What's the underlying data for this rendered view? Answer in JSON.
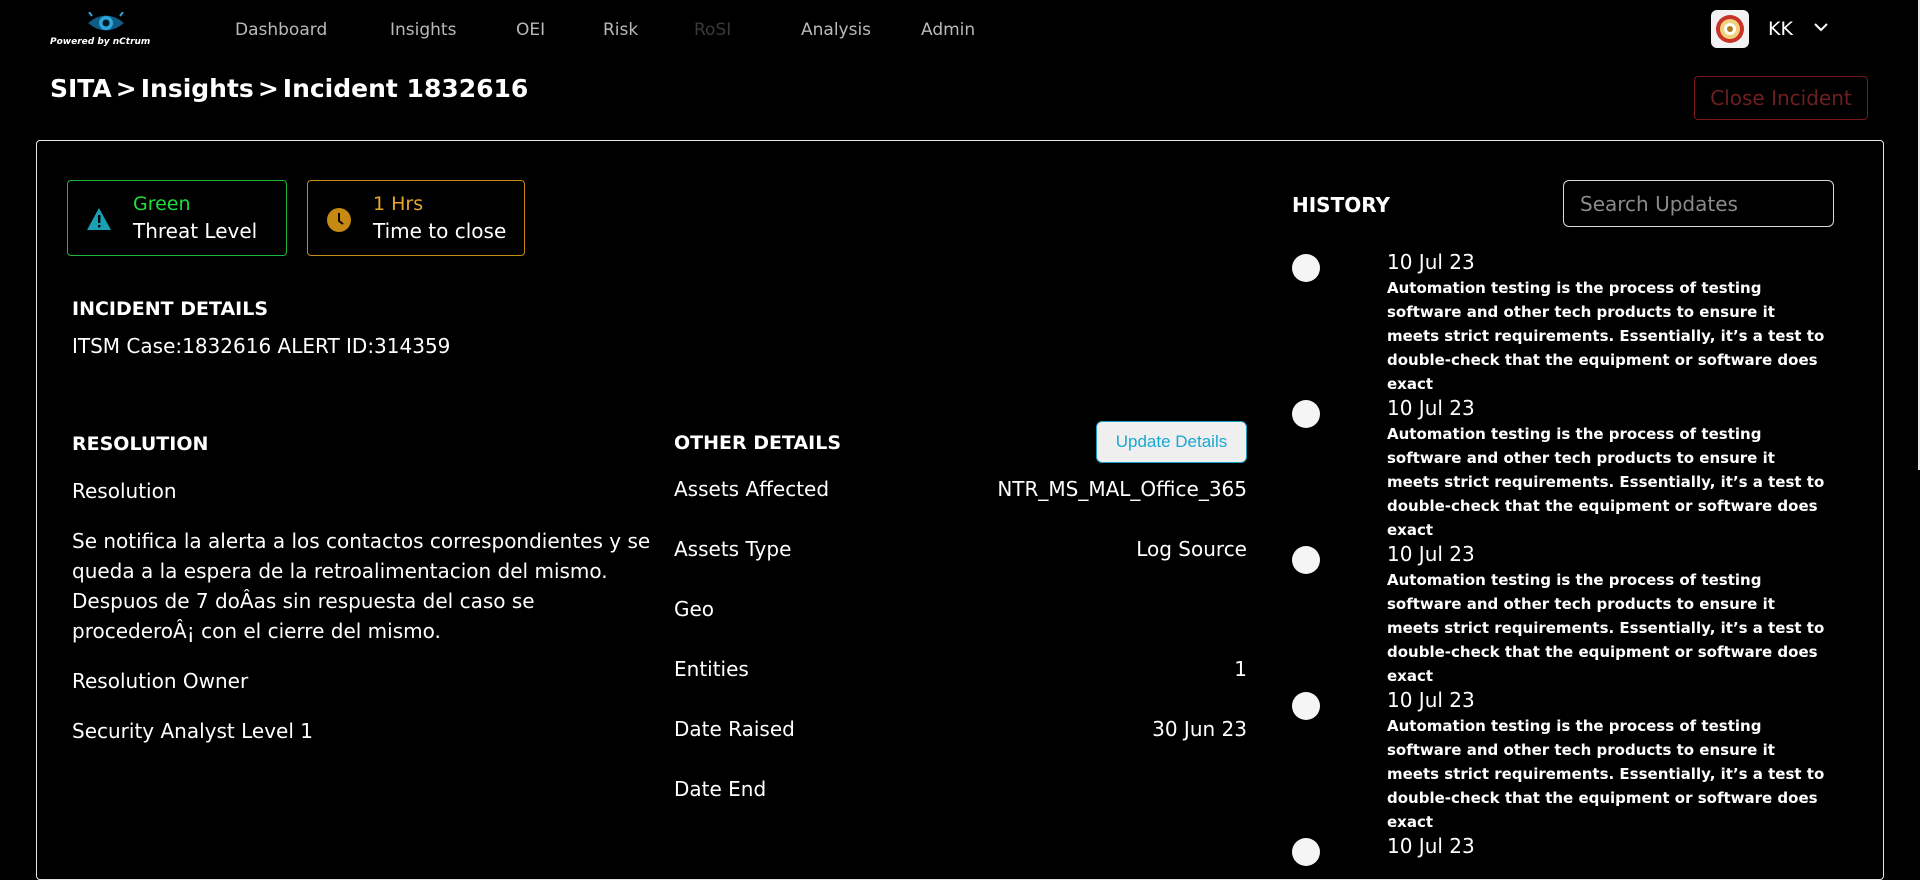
{
  "brand": {
    "powered_by": "Powered by nCtrum"
  },
  "nav": [
    {
      "label": "Dashboard",
      "disabled": false
    },
    {
      "label": "Insights",
      "disabled": false
    },
    {
      "label": "OEI",
      "disabled": false
    },
    {
      "label": "Risk",
      "disabled": false
    },
    {
      "label": "RoSI",
      "disabled": true
    },
    {
      "label": "Analysis",
      "disabled": false
    },
    {
      "label": "Admin",
      "disabled": false
    }
  ],
  "user": {
    "initials": "KK"
  },
  "breadcrumb": {
    "part1": "SITA",
    "part2": "Insights",
    "part3": "Incident 1832616",
    "separator": ">"
  },
  "actions": {
    "close_label": "Close Incident"
  },
  "kpis": {
    "threat": {
      "value": "Green",
      "label": "Threat Level"
    },
    "time": {
      "value": "1 Hrs",
      "label": "Time to close"
    }
  },
  "incident": {
    "heading": "INCIDENT DETAILS",
    "ids": "ITSM Case:1832616 ALERT ID:314359"
  },
  "resolution": {
    "heading": "RESOLUTION",
    "label": "Resolution",
    "text": "Se notifica la alerta a los contactos correspondientes y se queda a la espera de la retroalimentacion del mismo. Despuos de 7 doÂas sin respuesta del caso se procederoÂ¡ con el cierre del mismo.",
    "owner_label": "Resolution Owner",
    "owner": "Security Analyst Level 1"
  },
  "other": {
    "heading": "OTHER DETAILS",
    "update_label": "Update Details",
    "rows": [
      {
        "label": "Assets Affected",
        "value": "NTR_MS_MAL_Office_365"
      },
      {
        "label": "Assets Type",
        "value": "Log Source"
      },
      {
        "label": "Geo",
        "value": ""
      },
      {
        "label": "Entities",
        "value": "1"
      },
      {
        "label": "Date Raised",
        "value": "30 Jun 23"
      },
      {
        "label": "Date End",
        "value": ""
      }
    ]
  },
  "history": {
    "title": "HISTORY",
    "search_placeholder": "Search Updates",
    "items": [
      {
        "date": "10 Jul 23",
        "text": "Automation testing is the process of testing software and other tech products to ensure it meets strict requirements. Essentially, it’s a test to double-check that the equipment or software does exact"
      },
      {
        "date": "10 Jul 23",
        "text": "Automation testing is the process of testing software and other tech products to ensure it meets strict requirements. Essentially, it’s a test to double-check that the equipment or software does exact"
      },
      {
        "date": "10 Jul 23",
        "text": "Automation testing is the process of testing software and other tech products to ensure it meets strict requirements. Essentially, it’s a test to double-check that the equipment or software does exact"
      },
      {
        "date": "10 Jul 23",
        "text": "Automation testing is the process of testing software and other tech products to ensure it meets strict requirements. Essentially, it’s a test to double-check that the equipment or software does exact"
      },
      {
        "date": "10 Jul 23",
        "text": ""
      }
    ]
  },
  "colors": {
    "threat_green": "#1fdc3f",
    "time_amber": "#e7a62b",
    "close_red": "#7a1a1a",
    "update_blue": "#1ba7d1"
  }
}
